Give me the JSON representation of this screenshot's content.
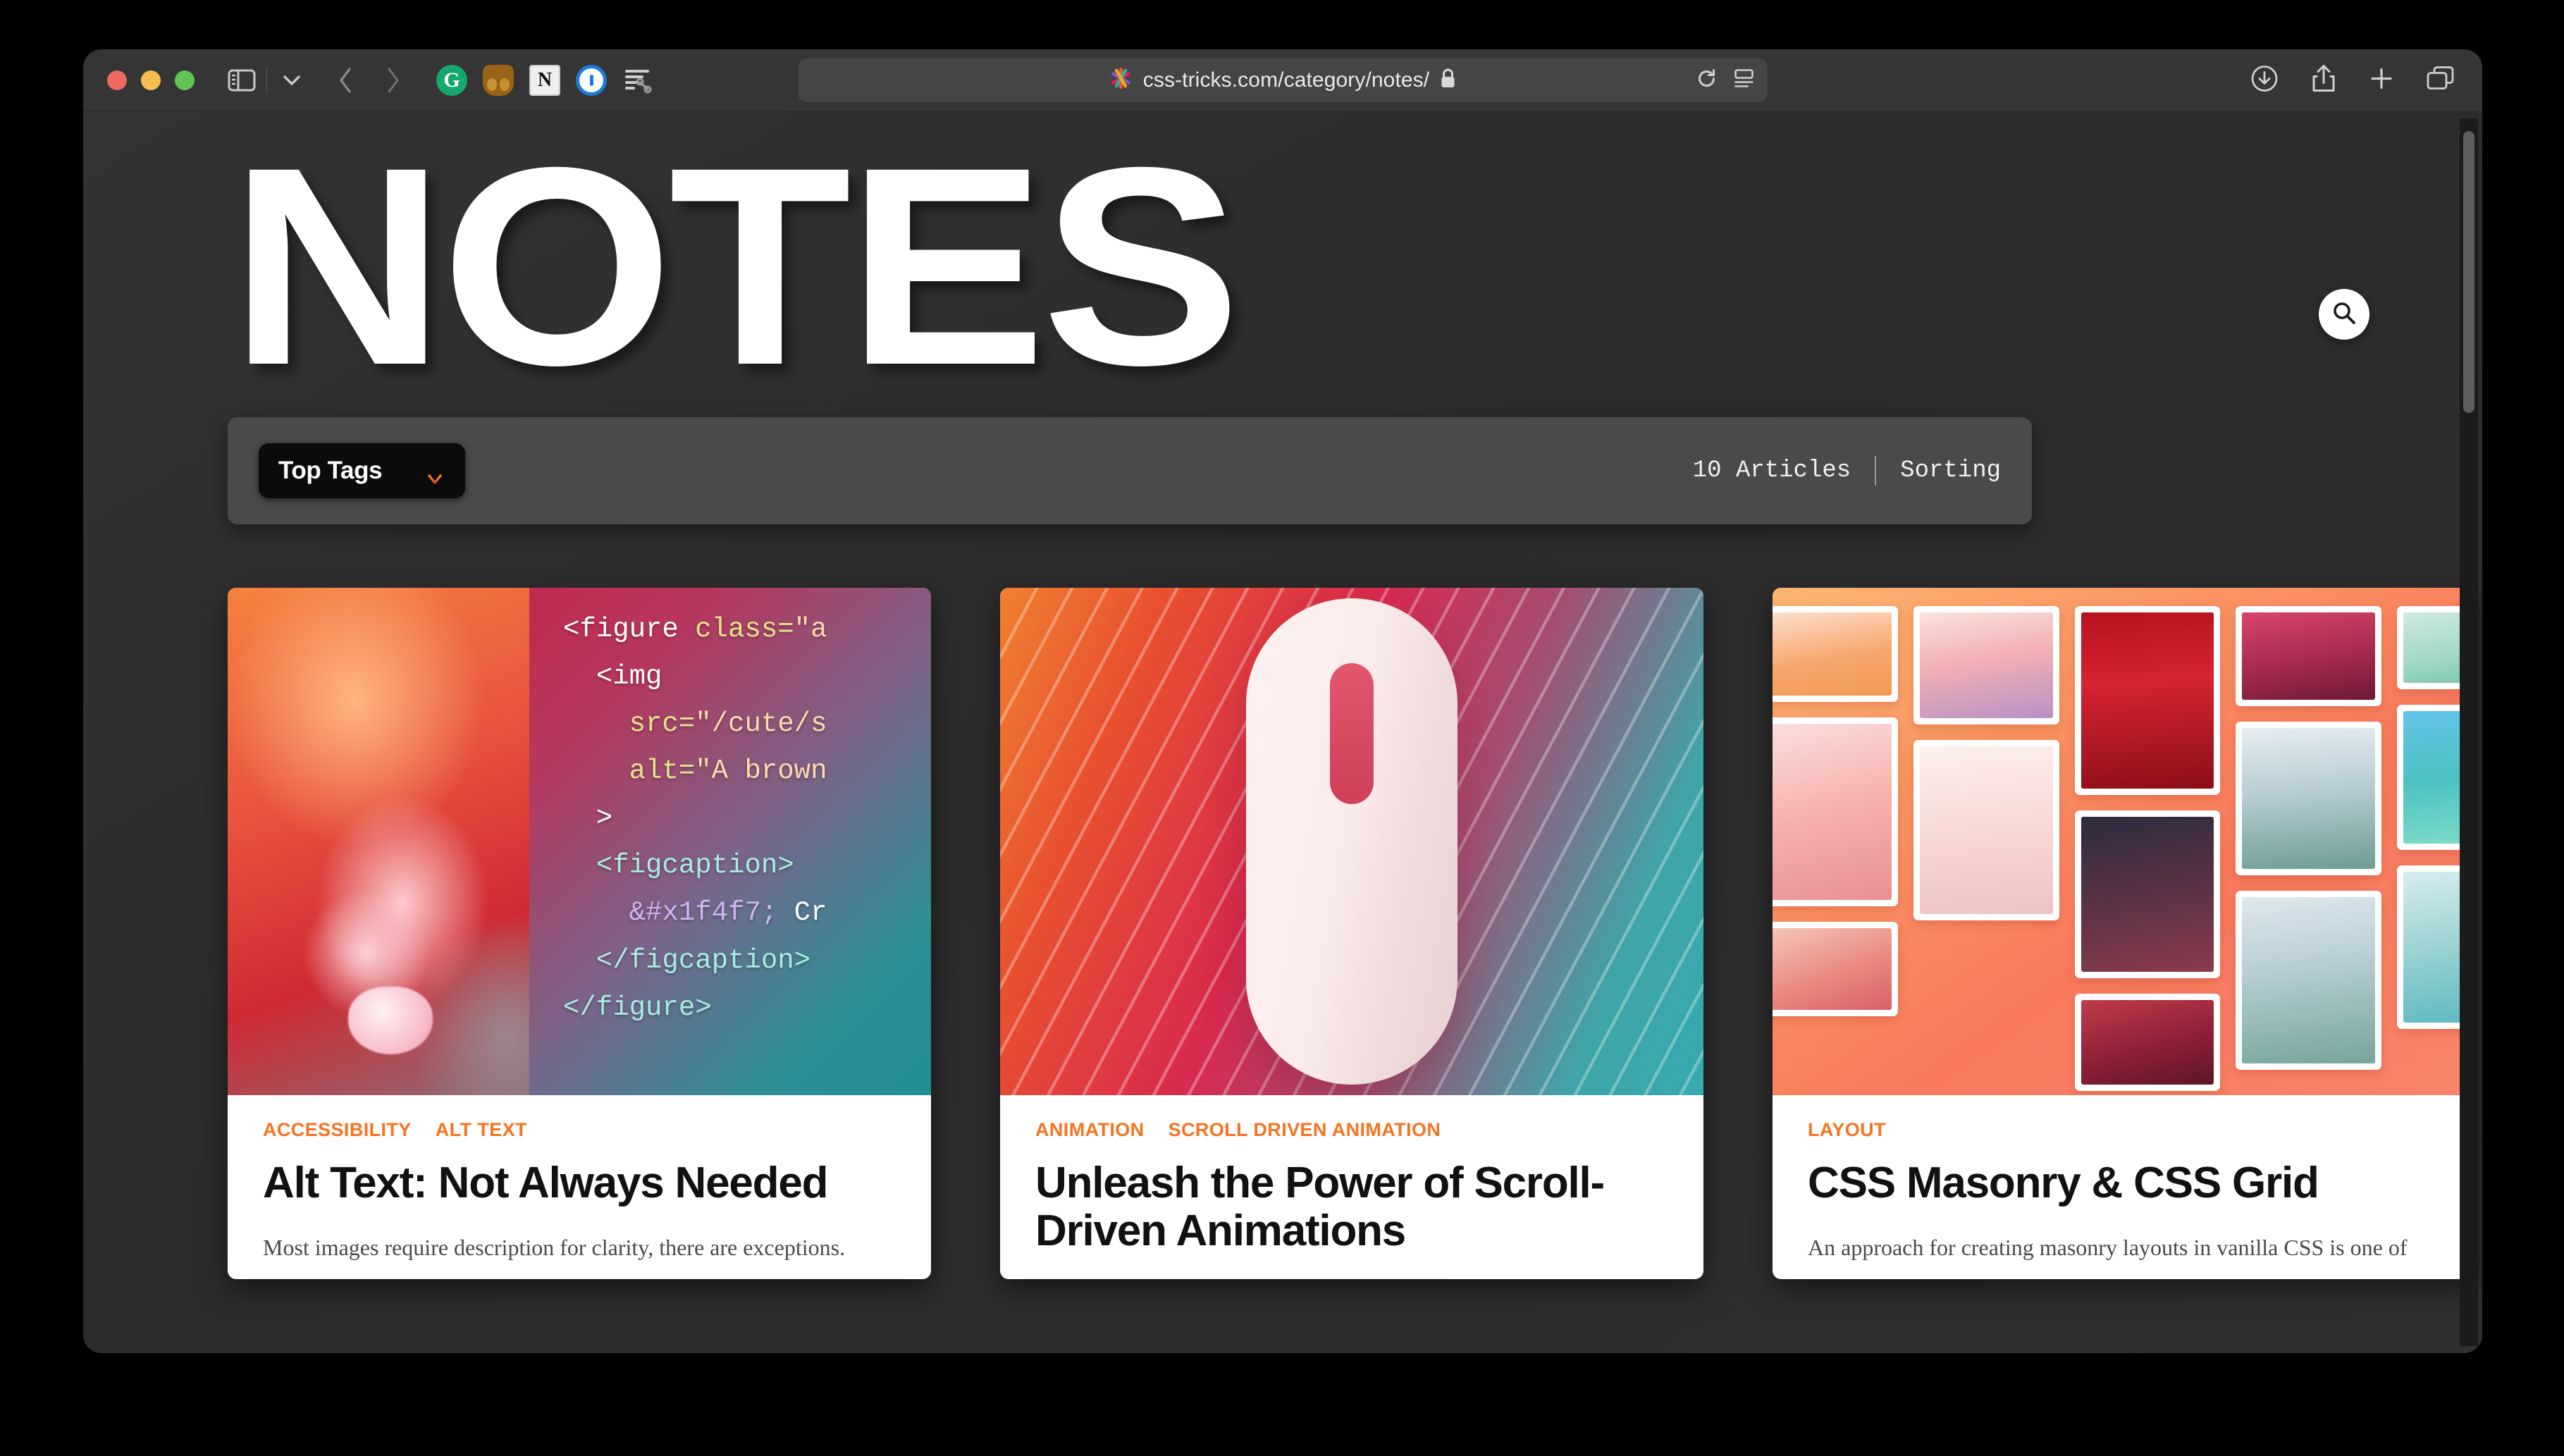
{
  "browser": {
    "window_controls": [
      "close",
      "minimize",
      "zoom"
    ],
    "sidebar_icon": "sidebar-icon",
    "chevron_icon": "chevron-down-icon",
    "back_label": "‹",
    "forward_label": "›",
    "extensions": [
      {
        "name": "grammarly",
        "glyph": "G"
      },
      {
        "name": "bitwarden",
        "glyph": ""
      },
      {
        "name": "notion",
        "glyph": "N"
      },
      {
        "name": "1password",
        "glyph": ""
      },
      {
        "name": "readwise",
        "glyph": ""
      }
    ],
    "url": "css-tricks.com/category/notes/",
    "favicon": "css-tricks-star-icon",
    "lock_icon": "lock-icon",
    "reload_icon": "reload-icon",
    "reader_icon": "reader-view-icon",
    "right_icons": [
      "downloads-icon",
      "share-icon",
      "new-tab-icon",
      "tab-overview-icon"
    ]
  },
  "page": {
    "hero_title": "NOTES",
    "search_button": "search-icon",
    "filter_bar": {
      "top_tags_label": "Top Tags",
      "top_tags_arrow": "arrow-down-icon",
      "article_count": "10 Articles",
      "sorting_label": "Sorting"
    },
    "cards": [
      {
        "media": "sloth-photo-with-html-code-overlay",
        "code_lines": [
          {
            "parts": [
              {
                "t": "<figure ",
                "c": "c-tag"
              },
              {
                "t": "class=",
                "c": "c-attr"
              },
              {
                "t": "\"a",
                "c": "c-str"
              }
            ]
          },
          {
            "parts": [
              {
                "t": "  <img",
                "c": "c-tag"
              }
            ]
          },
          {
            "parts": [
              {
                "t": "    ",
                "c": "c-tag"
              },
              {
                "t": "src=",
                "c": "c-attr"
              },
              {
                "t": "\"/cute/s",
                "c": "c-str"
              }
            ]
          },
          {
            "parts": [
              {
                "t": "    ",
                "c": "c-tag"
              },
              {
                "t": "alt=",
                "c": "c-attr"
              },
              {
                "t": "\"A brown",
                "c": "c-str"
              }
            ]
          },
          {
            "parts": [
              {
                "t": "  >",
                "c": "c-tag"
              }
            ]
          },
          {
            "parts": [
              {
                "t": "  <figcaption>",
                "c": "c-tag2"
              }
            ]
          },
          {
            "parts": [
              {
                "t": "    ",
                "c": "c-tag2"
              },
              {
                "t": "&#x1f4f7;",
                "c": "c-ent"
              },
              {
                "t": " Cr",
                "c": "c-tag"
              }
            ]
          },
          {
            "parts": [
              {
                "t": "  </figcaption>",
                "c": "c-tag2"
              }
            ]
          },
          {
            "parts": [
              {
                "t": "</figure>",
                "c": "c-tag2"
              }
            ]
          }
        ],
        "tags": [
          "ACCESSIBILITY",
          "ALT TEXT"
        ],
        "title": "Alt Text: Not Always Needed",
        "excerpt": "Most images require description for clarity, there are exceptions."
      },
      {
        "media": "computer-mouse-illustration-on-striped-gradient",
        "tags": [
          "ANIMATION",
          "SCROLL DRIVEN ANIMATION"
        ],
        "title": "Unleash the Power of Scroll-Driven Animations",
        "excerpt": ""
      },
      {
        "media": "masonry-photo-wall-on-coral-gradient",
        "tags": [
          "LAYOUT"
        ],
        "title": "CSS Masonry & CSS Grid",
        "excerpt": "An approach for creating masonry layouts in vanilla CSS is one of"
      }
    ]
  },
  "colors": {
    "accent_orange": "#F87320",
    "page_background": "#2E2E2E",
    "filter_bar_background": "#4A4A4A",
    "top_tags_background": "#0B0B0B",
    "card_background": "#FFFFFF",
    "chrome_background": "#353535"
  }
}
